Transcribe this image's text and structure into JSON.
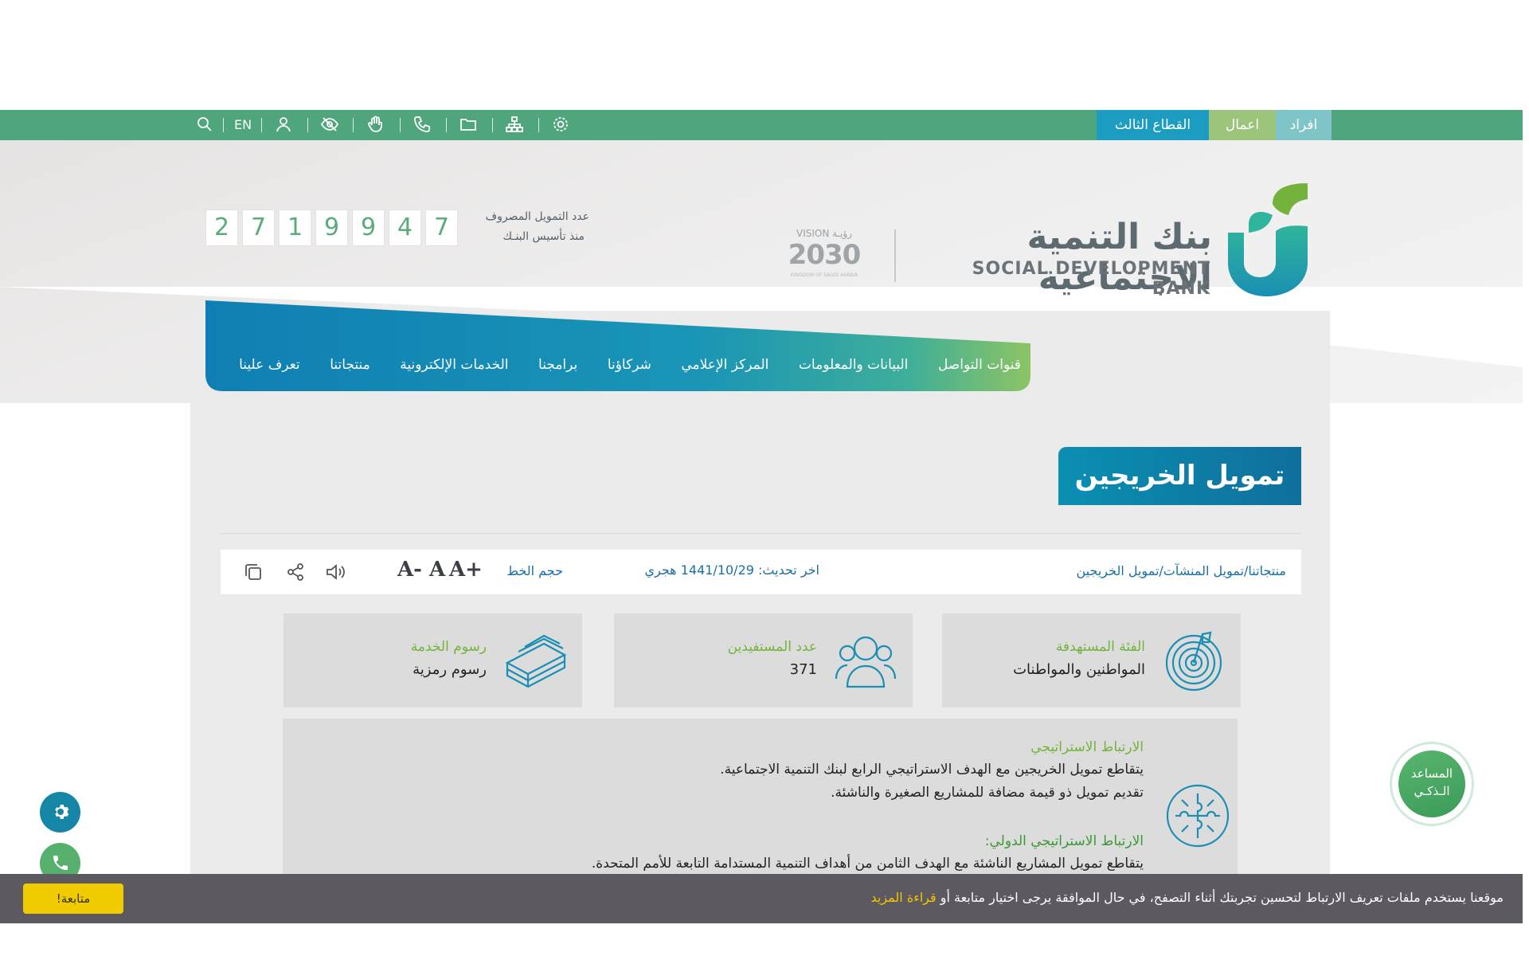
{
  "top_bar": {
    "segments": [
      "افراد",
      "اعمال",
      "القطاع الثالث"
    ],
    "lang_toggle": "EN"
  },
  "header": {
    "bank_name_ar": "بنك التنمية الاجتماعية",
    "bank_name_en": "SOCIAL DEVELOPMENT BANK",
    "vision_top": "VISION رؤيـة",
    "vision_number": "2030",
    "vision_sub": "KINGDOM OF SAUDI ARABIA"
  },
  "counter": {
    "label_line1": "عدد التمويل المصروف",
    "label_line2": "منذ تأسيس البنـك",
    "digits": [
      "2",
      "7",
      "1",
      "9",
      "9",
      "4",
      "7"
    ]
  },
  "nav": {
    "items": [
      "تعرف علينا",
      "منتجاتنا",
      "الخدمات الإلكترونية",
      "برامجنا",
      "شركاؤنا",
      "المركز الإعلامي",
      "البيانات والمعلومات",
      "قنوات التواصل"
    ]
  },
  "page_title": "تمويل الخريجين",
  "breadcrumb": {
    "path": "منتجاتنا/تمويل المنشآت/تمويل الخريجين",
    "last_updated": "اخر تحديث: 1441/10/29 هجري",
    "font_size_label": "حجم الخط",
    "font_buttons": [
      "A+",
      "A",
      "A-"
    ]
  },
  "cards": [
    {
      "title": "الفئة المستهدفة",
      "value": "المواطنين والمواطنات",
      "icon": "target-icon"
    },
    {
      "title": "عدد المستفيدين",
      "value": "371",
      "icon": "users-icon"
    },
    {
      "title": "رسوم الخدمة",
      "value": "رسوم رمزية",
      "icon": "money-stack-icon"
    }
  ],
  "strategy": {
    "heading1": "الارتباط الاستراتيجي",
    "line1": "يتقاطع تمويل الخريجين مع الهدف الاستراتيجي الرابع لبنك التنمية الاجتماعية.",
    "line2": "تقديم تمويل ذو قيمة مضافة للمشاريع الصغيرة والناشئة.",
    "heading2": "الارتباط الاستراتيجي الدولي:",
    "line3": "يتقاطع تمويل المشاريع الناشئة مع الهدف الثامن من أهداف التنمية المستدامة التابعة للأمم المتحدة.",
    "heading1_color": "#74b33b",
    "heading2_color": "#3a9a33"
  },
  "chat_widget": {
    "line1": "المساعد",
    "line2": "الـذكـي"
  },
  "cookie_bar": {
    "text": "موقعنا يستخدم ملفات تعريف الارتباط لتحسين تجربتك أثناء التصفح، في حال الموافقة يرجى اختيار متابعة أو",
    "link": "قراءة المزيد",
    "button": "متابعة!"
  },
  "colors": {
    "top_bar": "#4fa57c",
    "accent_blue": "#1586a6",
    "accent_green": "#74b33b",
    "cookie_bg": "#5d5960",
    "cookie_button": "#f0cb00"
  }
}
